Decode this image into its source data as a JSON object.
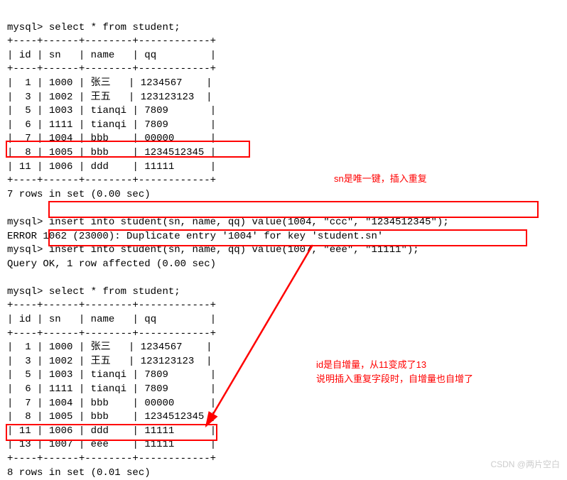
{
  "prompts": {
    "mysql": "mysql>"
  },
  "queries": {
    "select1": "select * from student;",
    "insert1": "insert into student(sn, name, qq) value(1004, \"ccc\", \"1234512345\");",
    "insert2": "insert into student(sn, name, qq) value(1007, \"eee\", \"11111\");",
    "select2": "select * from student;"
  },
  "error": "ERROR 1062 (23000): Duplicate entry '1004' for key 'student.sn'",
  "ok": "Query OK, 1 row affected (0.00 sec)",
  "headers": {
    "id": "id",
    "sn": "sn",
    "name": "name",
    "qq": "qq"
  },
  "table1": {
    "rows": [
      {
        "id": "1",
        "sn": "1000",
        "name": "张三",
        "qq": "1234567"
      },
      {
        "id": "3",
        "sn": "1002",
        "name": "王五",
        "qq": "123123123"
      },
      {
        "id": "5",
        "sn": "1003",
        "name": "tianqi",
        "qq": "7809"
      },
      {
        "id": "6",
        "sn": "1111",
        "name": "tianqi",
        "qq": "7809"
      },
      {
        "id": "7",
        "sn": "1004",
        "name": "bbb",
        "qq": "00000"
      },
      {
        "id": "8",
        "sn": "1005",
        "name": "bbb",
        "qq": "1234512345"
      },
      {
        "id": "11",
        "sn": "1006",
        "name": "ddd",
        "qq": "11111"
      }
    ],
    "footer": "7 rows in set (0.00 sec)"
  },
  "table2": {
    "rows": [
      {
        "id": "1",
        "sn": "1000",
        "name": "张三",
        "qq": "1234567"
      },
      {
        "id": "3",
        "sn": "1002",
        "name": "王五",
        "qq": "123123123"
      },
      {
        "id": "5",
        "sn": "1003",
        "name": "tianqi",
        "qq": "7809"
      },
      {
        "id": "6",
        "sn": "1111",
        "name": "tianqi",
        "qq": "7809"
      },
      {
        "id": "7",
        "sn": "1004",
        "name": "bbb",
        "qq": "00000"
      },
      {
        "id": "8",
        "sn": "1005",
        "name": "bbb",
        "qq": "1234512345"
      },
      {
        "id": "11",
        "sn": "1006",
        "name": "ddd",
        "qq": "11111"
      },
      {
        "id": "13",
        "sn": "1007",
        "name": "eee",
        "qq": "11111"
      }
    ],
    "footer": "8 rows in set (0.01 sec)"
  },
  "annotations": {
    "note1": "sn是唯一键，插入重复",
    "note2_line1": "id是自增量，从11变成了13",
    "note2_line2": "说明插入重复字段时，自增量也自增了"
  },
  "divider": "+----+------+--------+------------+",
  "watermark": "CSDN @两片空白"
}
